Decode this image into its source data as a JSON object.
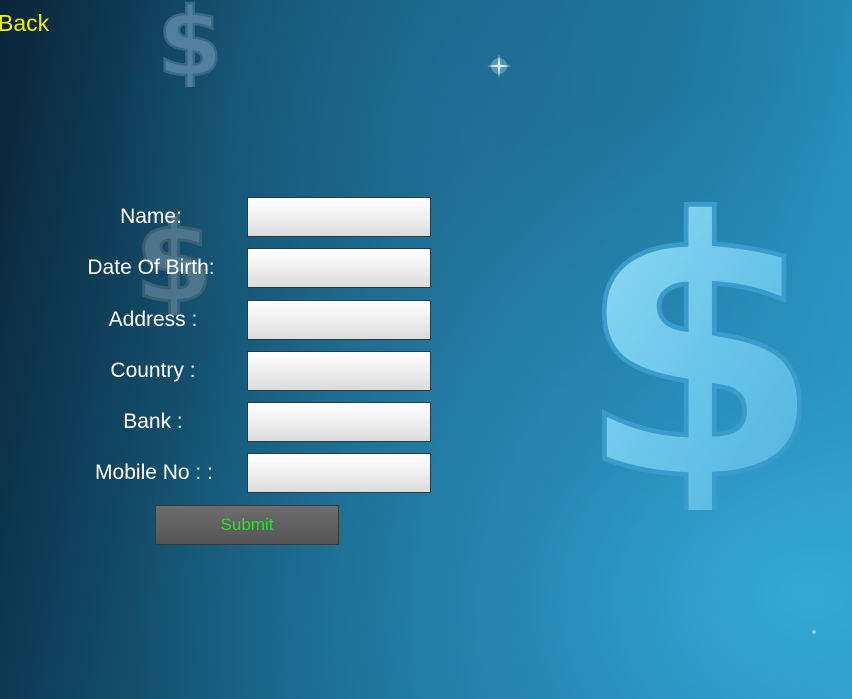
{
  "nav": {
    "back_label": "Back"
  },
  "form": {
    "fields": [
      {
        "label": "Name:"
      },
      {
        "label": "Date Of Birth:"
      },
      {
        "label": "Address :"
      },
      {
        "label": "Country :"
      },
      {
        "label": "Bank :"
      },
      {
        "label": "Mobile No : :"
      }
    ],
    "submit_label": "Submit"
  },
  "icons": {
    "decorations": [
      "dollar-sign-icon",
      "sparkle-icon"
    ]
  },
  "colors": {
    "back_link": "#f4f000",
    "label_text": "#ffffff",
    "submit_text": "#1fe61f",
    "submit_bg": "#5e5e5e",
    "background_dark": "#0a2438",
    "background_light": "#2a9cc8",
    "dollar_tint": "#7ccfee"
  }
}
